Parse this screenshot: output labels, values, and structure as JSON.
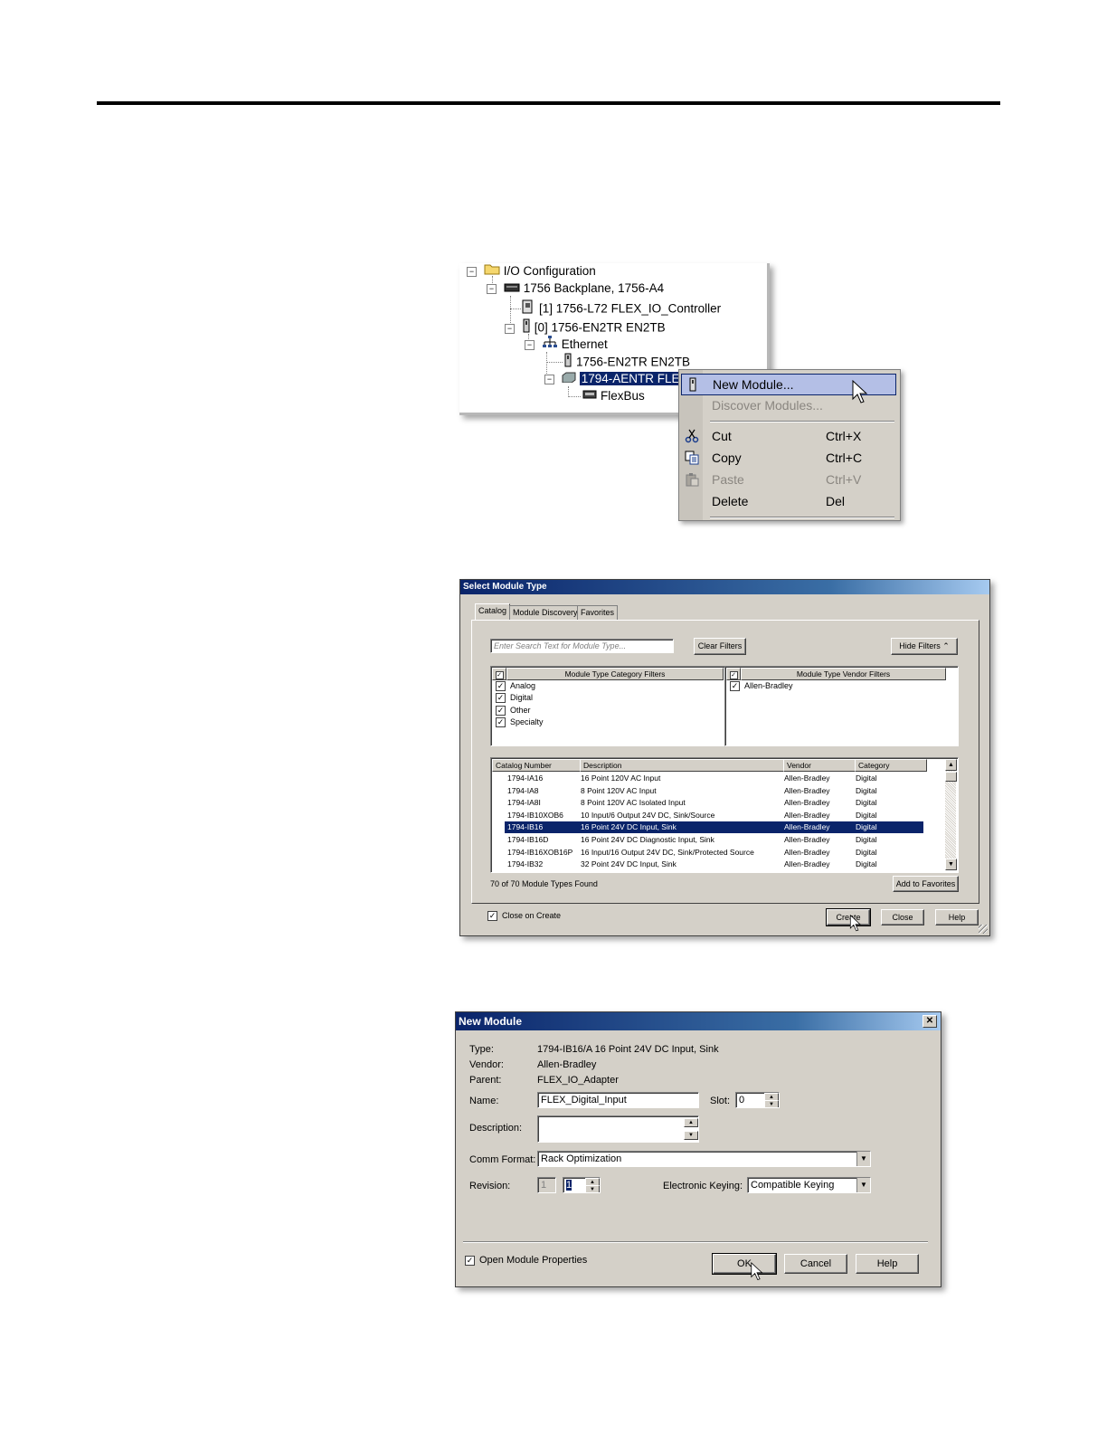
{
  "tree": {
    "nodes": [
      {
        "label": "I/O Configuration",
        "icon": "folder-icon"
      },
      {
        "label": "1756 Backplane, 1756-A4",
        "icon": "backplane-icon"
      },
      {
        "label": "[1] 1756-L72 FLEX_IO_Controller",
        "icon": "controller-icon"
      },
      {
        "label": "[0] 1756-EN2TR EN2TB",
        "icon": "module-icon"
      },
      {
        "label": "Ethernet",
        "icon": "network-icon"
      },
      {
        "label": "1756-EN2TR EN2TB",
        "icon": "module-icon"
      },
      {
        "label": "1794-AENTR FLE",
        "icon": "adapter-icon"
      },
      {
        "label": "FlexBus",
        "icon": "flexbus-icon"
      }
    ]
  },
  "context_menu": {
    "items": [
      {
        "label": "New Module...",
        "shortcut": "",
        "icon": "new-module-icon",
        "state": "highlighted"
      },
      {
        "label": "Discover Modules...",
        "shortcut": "",
        "icon": "",
        "state": "disabled"
      },
      {
        "label": "Cut",
        "shortcut": "Ctrl+X",
        "icon": "scissors-icon",
        "state": "enabled"
      },
      {
        "label": "Copy",
        "shortcut": "Ctrl+C",
        "icon": "copy-icon",
        "state": "enabled"
      },
      {
        "label": "Paste",
        "shortcut": "Ctrl+V",
        "icon": "paste-icon",
        "state": "disabled"
      },
      {
        "label": "Delete",
        "shortcut": "Del",
        "icon": "",
        "state": "enabled"
      }
    ]
  },
  "select_module": {
    "title": "Select Module Type",
    "tabs": [
      "Catalog",
      "Module Discovery",
      "Favorites"
    ],
    "search_placeholder": "Enter Search Text for Module Type...",
    "clear_filters": "Clear Filters",
    "hide_filters": "Hide Filters",
    "category_header": "Module Type Category Filters",
    "vendor_header": "Module Type Vendor Filters",
    "categories": [
      "Analog",
      "Digital",
      "Other",
      "Specialty"
    ],
    "vendors": [
      "Allen-Bradley"
    ],
    "columns": [
      "Catalog Number",
      "Description",
      "Vendor",
      "Category"
    ],
    "rows": [
      [
        "1794-IA16",
        "16 Point 120V AC Input",
        "Allen-Bradley",
        "Digital"
      ],
      [
        "1794-IA8",
        "8 Point 120V AC Input",
        "Allen-Bradley",
        "Digital"
      ],
      [
        "1794-IA8I",
        "8 Point 120V AC Isolated Input",
        "Allen-Bradley",
        "Digital"
      ],
      [
        "1794-IB10XOB6",
        "10 Input/6 Output 24V DC, Sink/Source",
        "Allen-Bradley",
        "Digital"
      ],
      [
        "1794-IB16",
        "16 Point 24V DC Input, Sink",
        "Allen-Bradley",
        "Digital"
      ],
      [
        "1794-IB16D",
        "16 Point 24V DC Diagnostic Input, Sink",
        "Allen-Bradley",
        "Digital"
      ],
      [
        "1794-IB16XOB16P",
        "16 Input/16 Output 24V DC, Sink/Protected Source",
        "Allen-Bradley",
        "Digital"
      ],
      [
        "1794-IB32",
        "32 Point 24V DC Input, Sink",
        "Allen-Bradley",
        "Digital"
      ]
    ],
    "selected_row": 4,
    "found_text": "70  of 70 Module Types Found",
    "add_favorites": "Add to Favorites",
    "close_on_create": "Close on Create",
    "create": "Create",
    "close": "Close",
    "help": "Help"
  },
  "new_module": {
    "title": "New Module",
    "type_label": "Type:",
    "type_value": "1794-IB16/A 16 Point 24V DC Input, Sink",
    "vendor_label": "Vendor:",
    "vendor_value": "Allen-Bradley",
    "parent_label": "Parent:",
    "parent_value": "FLEX_IO_Adapter",
    "name_label": "Name:",
    "name_value": "FLEX_Digital_Input",
    "slot_label": "Slot:",
    "slot_value": "0",
    "description_label": "Description:",
    "description_value": "",
    "comm_label": "Comm Format:",
    "comm_value": "Rack Optimization",
    "revision_label": "Revision:",
    "revision_major": "1",
    "revision_minor": "1",
    "keying_label": "Electronic Keying:",
    "keying_value": "Compatible Keying",
    "open_props": "Open Module Properties",
    "ok": "OK",
    "cancel": "Cancel",
    "help": "Help"
  }
}
